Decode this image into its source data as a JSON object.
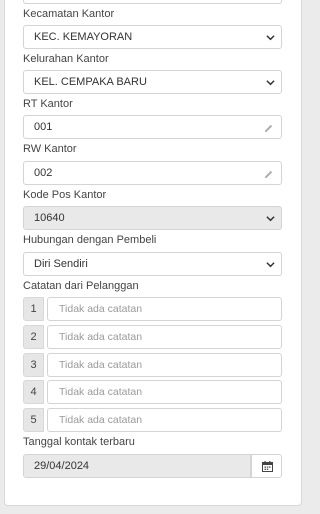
{
  "kecamatan": {
    "label": "Kecamatan Kantor",
    "value": "KEC. KEMAYORAN"
  },
  "kelurahan": {
    "label": "Kelurahan Kantor",
    "value": "KEL. CEMPAKA BARU"
  },
  "rt": {
    "label": "RT Kantor",
    "value": "001"
  },
  "rw": {
    "label": "RW Kantor",
    "value": "002"
  },
  "kodepos": {
    "label": "Kode Pos Kantor",
    "value": "10640"
  },
  "hubungan": {
    "label": "Hubungan dengan Pembeli",
    "value": "Diri Sendiri"
  },
  "catatan": {
    "label": "Catatan dari Pelanggan",
    "items": [
      {
        "num": "1",
        "placeholder": "Tidak ada catatan"
      },
      {
        "num": "2",
        "placeholder": "Tidak ada catatan"
      },
      {
        "num": "3",
        "placeholder": "Tidak ada catatan"
      },
      {
        "num": "4",
        "placeholder": "Tidak ada catatan"
      },
      {
        "num": "5",
        "placeholder": "Tidak ada catatan"
      }
    ]
  },
  "tanggal": {
    "label": "Tanggal kontak terbaru",
    "value": "29/04/2024"
  },
  "icons": {
    "select": "chevron-down-icon",
    "edit": "pencil-icon",
    "date": "calendar-icon"
  }
}
